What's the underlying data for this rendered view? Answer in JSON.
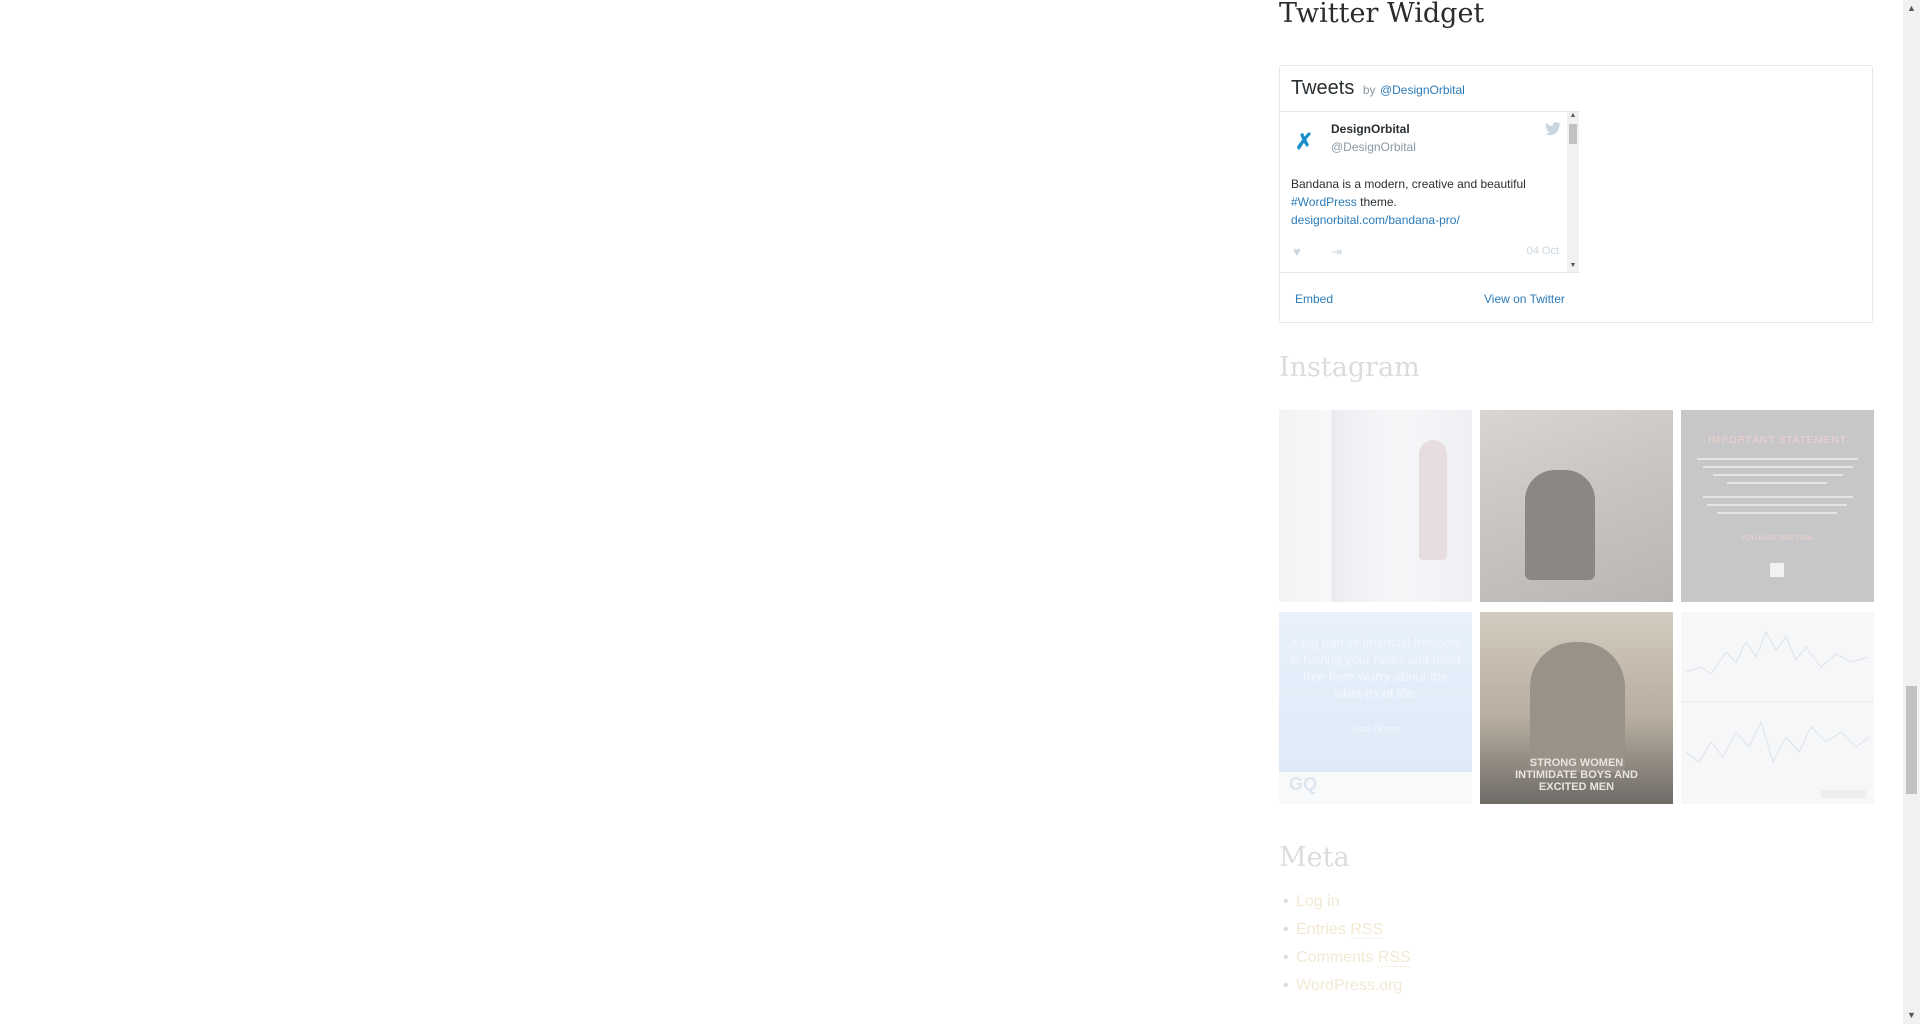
{
  "twitter_widget": {
    "title": "Twitter Widget",
    "header": {
      "tweets_label": "Tweets",
      "by_label": "by",
      "handle": "@DesignOrbital"
    },
    "tweet": {
      "author_name": "DesignOrbital",
      "author_handle": "@DesignOrbital",
      "text_line1": "Bandana is a modern, creative and beautiful",
      "hashtag": "#WordPress",
      "text_line2_rest": " theme.",
      "link": "designorbital.com/bandana-pro/",
      "date": "04 Oct"
    },
    "footer": {
      "embed_label": "Embed",
      "view_label": "View on Twitter"
    }
  },
  "instagram_widget": {
    "title": "Instagram",
    "tiles": [
      {
        "name": "instagram-photo-window"
      },
      {
        "name": "instagram-photo-cafe"
      },
      {
        "name": "instagram-photo-announcement",
        "heading": "IMPORTANT STATEMENT",
        "footer": "YOU HAVE ONE TASK"
      },
      {
        "name": "instagram-photo-quote",
        "quote": "A big part of financial freedom is having your heart and mind free from worry about the what-ifs of life.",
        "author": "Suze Orman",
        "logo": "GQ"
      },
      {
        "name": "instagram-photo-couple",
        "caption": "STRONG WOMEN INTIMIDATE BOYS AND EXCITED MEN"
      },
      {
        "name": "instagram-photo-chart"
      }
    ]
  },
  "meta_widget": {
    "title": "Meta",
    "items": [
      {
        "label": "Log in"
      },
      {
        "label": "Entries ",
        "suffix": "RSS"
      },
      {
        "label": "Comments ",
        "suffix": "RSS"
      },
      {
        "label": "WordPress.org"
      }
    ]
  }
}
